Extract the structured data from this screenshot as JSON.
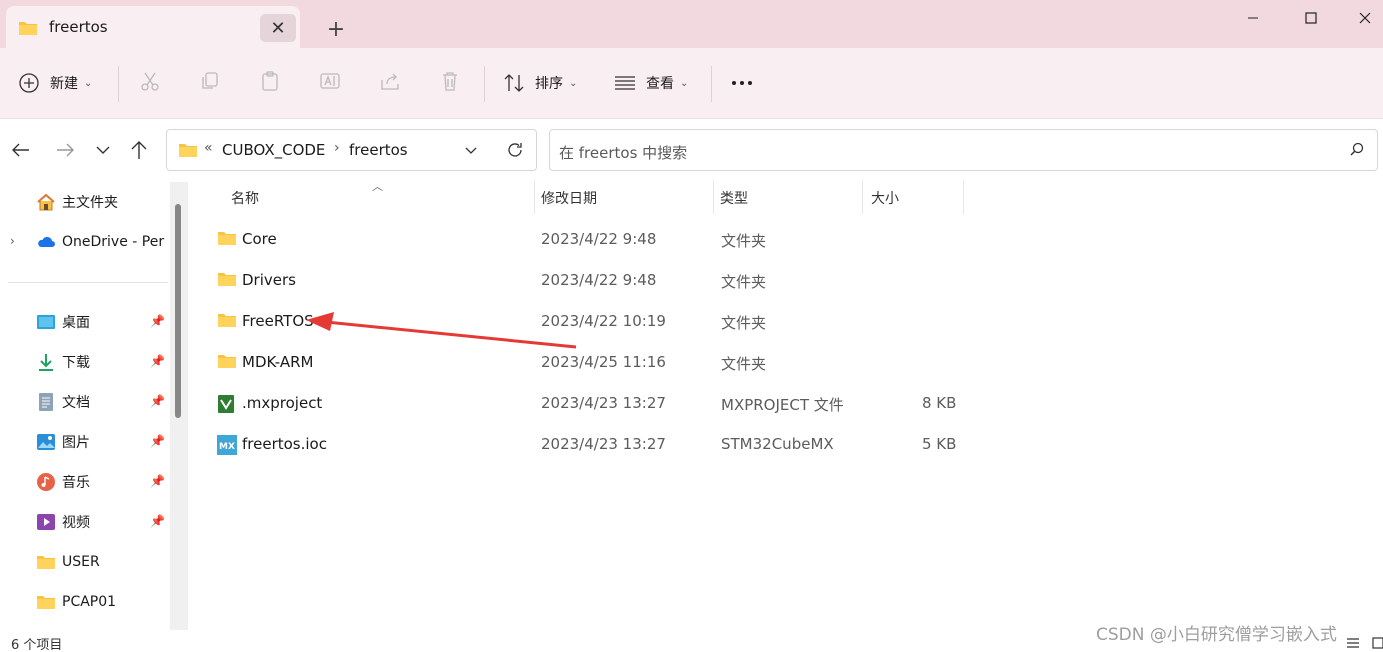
{
  "tab": {
    "title": "freertos",
    "close_icon": "close-icon",
    "new_tab_icon": "plus-icon"
  },
  "window": {
    "minimize_icon": "minimize-icon",
    "maximize_icon": "maximize-icon",
    "close_icon": "close-icon"
  },
  "toolbar": {
    "new_label": "新建",
    "sort_label": "排序",
    "view_label": "查看",
    "more_icon": "more-icon",
    "icons": [
      "cut-icon",
      "copy-icon",
      "paste-icon",
      "rename-icon",
      "share-icon",
      "delete-icon"
    ]
  },
  "address": {
    "overflow": "«",
    "crumbs": [
      "CUBOX_CODE",
      "freertos"
    ],
    "separator": "›"
  },
  "search": {
    "placeholder": "在 freertos 中搜索"
  },
  "sidebar": {
    "items": [
      {
        "label": "主文件夹",
        "icon": "home-icon"
      },
      {
        "label": "OneDrive - Per",
        "icon": "cloud-icon"
      },
      {
        "label": "桌面",
        "icon": "desktop-icon",
        "pinned": true
      },
      {
        "label": "下载",
        "icon": "download-icon",
        "pinned": true
      },
      {
        "label": "文档",
        "icon": "document-icon",
        "pinned": true
      },
      {
        "label": "图片",
        "icon": "picture-icon",
        "pinned": true
      },
      {
        "label": "音乐",
        "icon": "music-icon",
        "pinned": true
      },
      {
        "label": "视频",
        "icon": "video-icon",
        "pinned": true
      },
      {
        "label": "USER",
        "icon": "folder-icon"
      },
      {
        "label": "PCAP01",
        "icon": "folder-icon"
      }
    ]
  },
  "columns": {
    "name": "名称",
    "date": "修改日期",
    "type": "类型",
    "size": "大小"
  },
  "files": [
    {
      "name": "Core",
      "date": "2023/4/22 9:48",
      "type": "文件夹",
      "size": "",
      "icon": "folder-icon"
    },
    {
      "name": "Drivers",
      "date": "2023/4/22 9:48",
      "type": "文件夹",
      "size": "",
      "icon": "folder-icon"
    },
    {
      "name": "FreeRTOS",
      "date": "2023/4/22 10:19",
      "type": "文件夹",
      "size": "",
      "icon": "folder-icon"
    },
    {
      "name": "MDK-ARM",
      "date": "2023/4/25 11:16",
      "type": "文件夹",
      "size": "",
      "icon": "folder-icon"
    },
    {
      "name": ".mxproject",
      "date": "2023/4/23 13:27",
      "type": "MXPROJECT 文件",
      "size": "8 KB",
      "icon": "mxproject-file-icon"
    },
    {
      "name": "freertos.ioc",
      "date": "2023/4/23 13:27",
      "type": "STM32CubeMX",
      "size": "5 KB",
      "icon": "stm32cubemx-file-icon"
    }
  ],
  "status": {
    "count": "6 个项目"
  },
  "watermark": "CSDN @小白研究僧学习嵌入式",
  "colors": {
    "tabbar": "#f2d9e0",
    "toolbar": "#f9eef1",
    "annotation_arrow": "#e53935",
    "folder": "#f6c343"
  }
}
